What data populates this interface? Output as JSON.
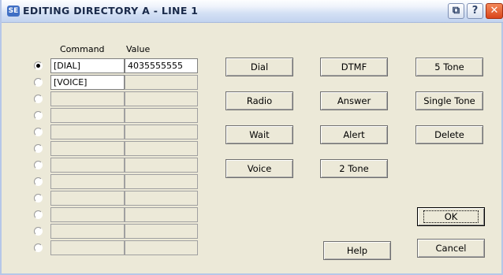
{
  "window": {
    "icon_text": "SE",
    "title": "EDITING DIRECTORY A - LINE 1",
    "titlebar_buttons": {
      "restore": "⧉",
      "help": "?",
      "close": "✕"
    }
  },
  "grid": {
    "headers": {
      "command": "Command",
      "value": "Value"
    },
    "rows": [
      {
        "command": "[DIAL]",
        "value": "4035555555",
        "selected": true
      },
      {
        "command": "[VOICE]",
        "value": "",
        "selected": false
      },
      {
        "command": "",
        "value": "",
        "selected": false
      },
      {
        "command": "",
        "value": "",
        "selected": false
      },
      {
        "command": "",
        "value": "",
        "selected": false
      },
      {
        "command": "",
        "value": "",
        "selected": false
      },
      {
        "command": "",
        "value": "",
        "selected": false
      },
      {
        "command": "",
        "value": "",
        "selected": false
      },
      {
        "command": "",
        "value": "",
        "selected": false
      },
      {
        "command": "",
        "value": "",
        "selected": false
      },
      {
        "command": "",
        "value": "",
        "selected": false
      },
      {
        "command": "",
        "value": "",
        "selected": false
      }
    ]
  },
  "buttons": {
    "dial": "Dial",
    "dtmf": "DTMF",
    "five_tone": "5 Tone",
    "radio": "Radio",
    "answer": "Answer",
    "single_tone": "Single Tone",
    "wait": "Wait",
    "alert": "Alert",
    "delete": "Delete",
    "voice": "Voice",
    "two_tone": "2 Tone",
    "ok": "OK",
    "help": "Help",
    "cancel": "Cancel"
  },
  "colors": {
    "dialog_bg": "#ece9d8",
    "close_button": "#d9441a",
    "titlebar": "#d3e0f4"
  }
}
